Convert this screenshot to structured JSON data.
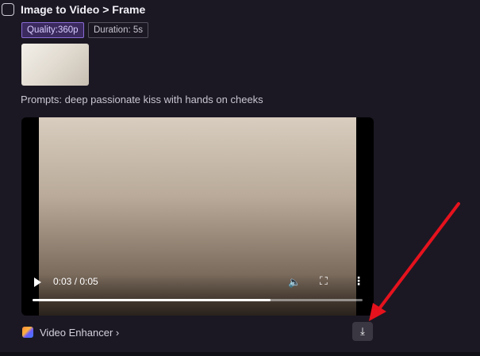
{
  "header": {
    "title": "Image to Video > Frame",
    "icon": "image-add-icon"
  },
  "tags": {
    "quality": "Quality:360p",
    "duration": "Duration: 5s"
  },
  "prompt_line": "Prompts:  deep passionate kiss with hands on cheeks",
  "player": {
    "timecode": "0:03 / 0:05",
    "progress": 0.72,
    "icons": {
      "play": "play-icon",
      "mute": "volume-icon",
      "fullscreen": "fullscreen-icon",
      "more": "more-vertical-icon"
    }
  },
  "enhancer": {
    "label": "Video Enhancer ›",
    "icon": "video-enhancer-icon"
  },
  "download": {
    "icon": "download-icon"
  },
  "annotation": {
    "color": "#e5121d",
    "icon": "red-arrow-annotation"
  },
  "colors": {
    "accent": "#8a6bd6",
    "background": "#1b1823"
  }
}
